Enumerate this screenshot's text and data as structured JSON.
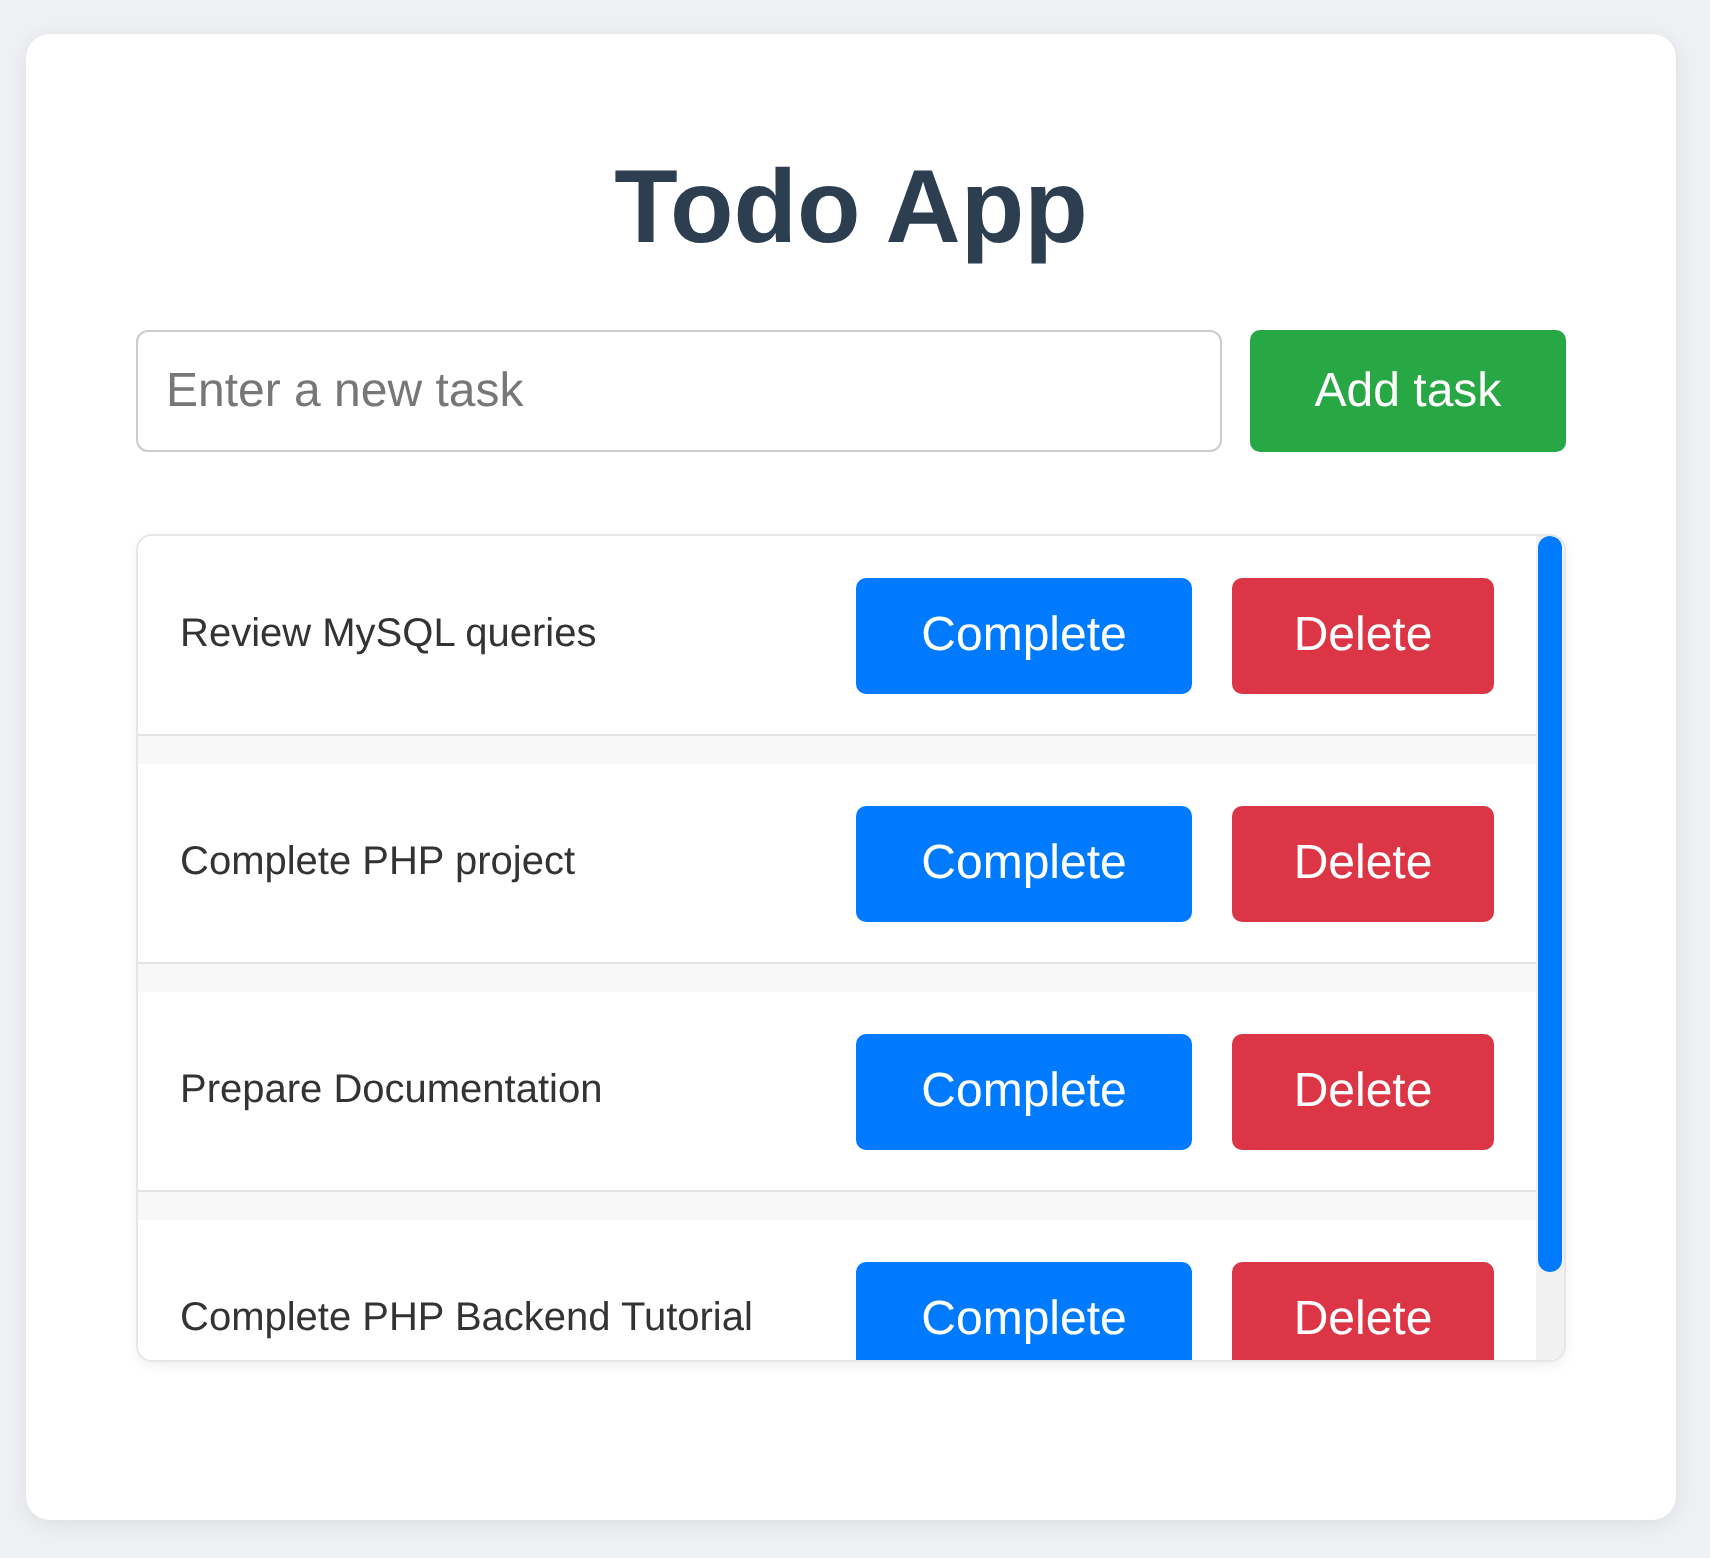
{
  "title": "Todo App",
  "new_task": {
    "placeholder": "Enter a new task"
  },
  "add_button": "Add task",
  "tasks": [
    {
      "text": "Review MySQL queries",
      "complete_label": "Complete",
      "delete_label": "Delete"
    },
    {
      "text": "Complete PHP project",
      "complete_label": "Complete",
      "delete_label": "Delete"
    },
    {
      "text": "Prepare Documentation",
      "complete_label": "Complete",
      "delete_label": "Delete"
    },
    {
      "text": "Complete PHP Backend Tutorial",
      "complete_label": "Complete",
      "delete_label": "Delete"
    }
  ]
}
